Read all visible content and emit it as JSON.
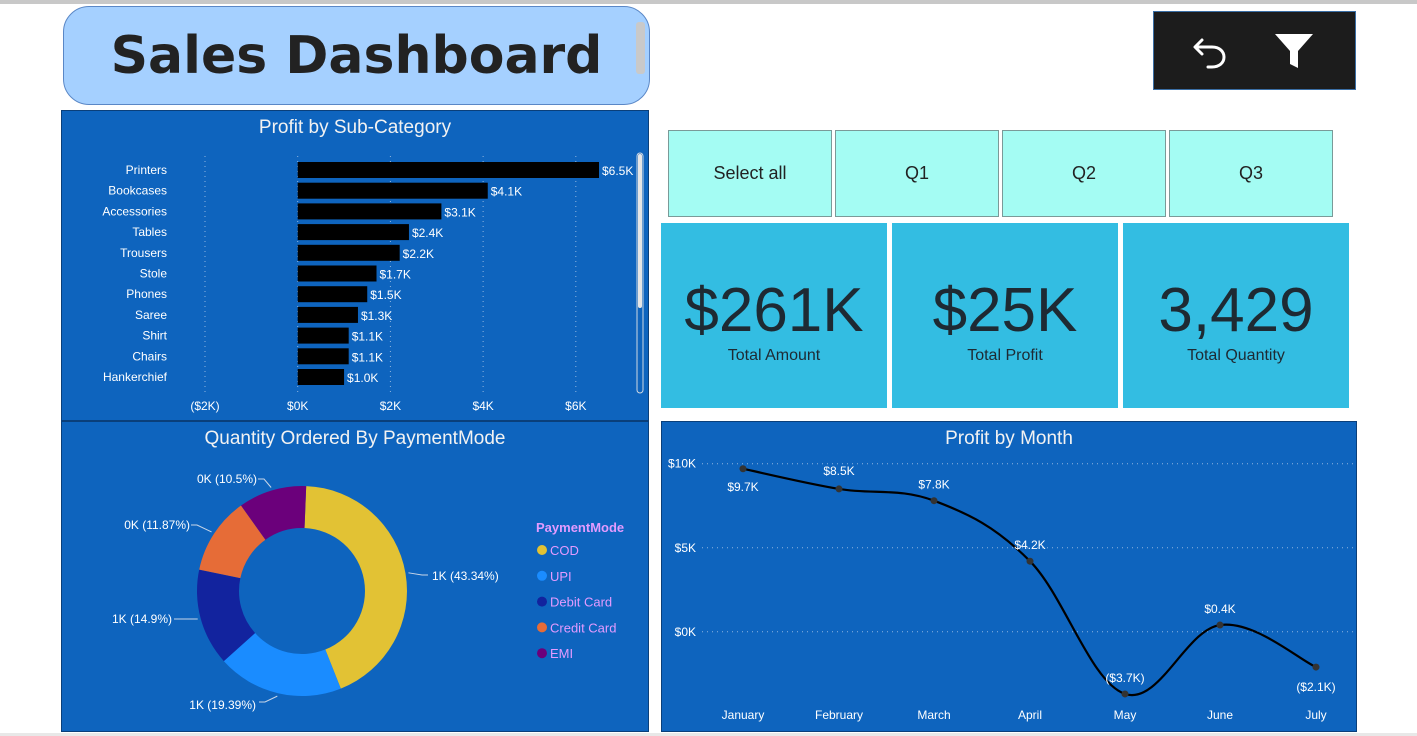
{
  "title": "Sales Dashboard",
  "toolbar": {
    "undo_icon": "undo-icon",
    "filter_icon": "filter-icon"
  },
  "slicers": [
    "Select all",
    "Q1",
    "Q2",
    "Q3"
  ],
  "cards": [
    {
      "value": "$261K",
      "label": "Total Amount"
    },
    {
      "value": "$25K",
      "label": "Total Profit"
    },
    {
      "value": "3,429",
      "label": "Total Quantity"
    }
  ],
  "colors": {
    "panel": "#0e64be",
    "bar": "#000000",
    "slicer": "#a4fcf3",
    "card": "#33bde2",
    "title_box": "#a5d0ff",
    "legend_title": "#e39bff"
  },
  "chart_data": [
    {
      "type": "bar",
      "orientation": "horizontal",
      "title": "Profit by Sub-Category",
      "categories": [
        "Printers",
        "Bookcases",
        "Accessories",
        "Tables",
        "Trousers",
        "Stole",
        "Phones",
        "Saree",
        "Shirt",
        "Chairs",
        "Hankerchief"
      ],
      "values": [
        6500,
        4100,
        3100,
        2400,
        2200,
        1700,
        1500,
        1300,
        1100,
        1100,
        1000
      ],
      "data_labels": [
        "$6.5K",
        "$4.1K",
        "$3.1K",
        "$2.4K",
        "$2.2K",
        "$1.7K",
        "$1.5K",
        "$1.3K",
        "$1.1K",
        "$1.1K",
        "$1.0K"
      ],
      "x_ticks": [
        -2000,
        0,
        2000,
        4000,
        6000
      ],
      "x_tick_labels": [
        "($2K)",
        "$0K",
        "$2K",
        "$4K",
        "$6K"
      ],
      "xlim": [
        -2000,
        6500
      ],
      "grid": true
    },
    {
      "type": "pie",
      "donut": true,
      "title": "Quantity Ordered By PaymentMode",
      "legend_title": "PaymentMode",
      "legend_position": "right",
      "slices": [
        {
          "name": "COD",
          "percent": 43.34,
          "label": "1K (43.34%)",
          "color": "#e2c234"
        },
        {
          "name": "UPI",
          "percent": 19.39,
          "label": "1K (19.39%)",
          "color": "#1a8cff"
        },
        {
          "name": "Debit Card",
          "percent": 14.9,
          "label": "1K (14.9%)",
          "color": "#12239e"
        },
        {
          "name": "Credit Card",
          "percent": 11.87,
          "label": "0K (11.87%)",
          "color": "#e66c37"
        },
        {
          "name": "EMI",
          "percent": 10.5,
          "label": "0K (10.5%)",
          "color": "#6b007b"
        }
      ]
    },
    {
      "type": "line",
      "title": "Profit by Month",
      "categories": [
        "January",
        "February",
        "March",
        "April",
        "May",
        "June",
        "July"
      ],
      "values": [
        9700,
        8500,
        7800,
        4200,
        -3700,
        400,
        -2100
      ],
      "data_labels": [
        "$9.7K",
        "$8.5K",
        "$7.8K",
        "$4.2K",
        "($3.7K)",
        "$0.4K",
        "($2.1K)"
      ],
      "y_ticks": [
        0,
        5000,
        10000
      ],
      "y_tick_labels": [
        "$0K",
        "$5K",
        "$10K"
      ],
      "ylim": [
        -4000,
        10400
      ],
      "grid": true
    }
  ]
}
